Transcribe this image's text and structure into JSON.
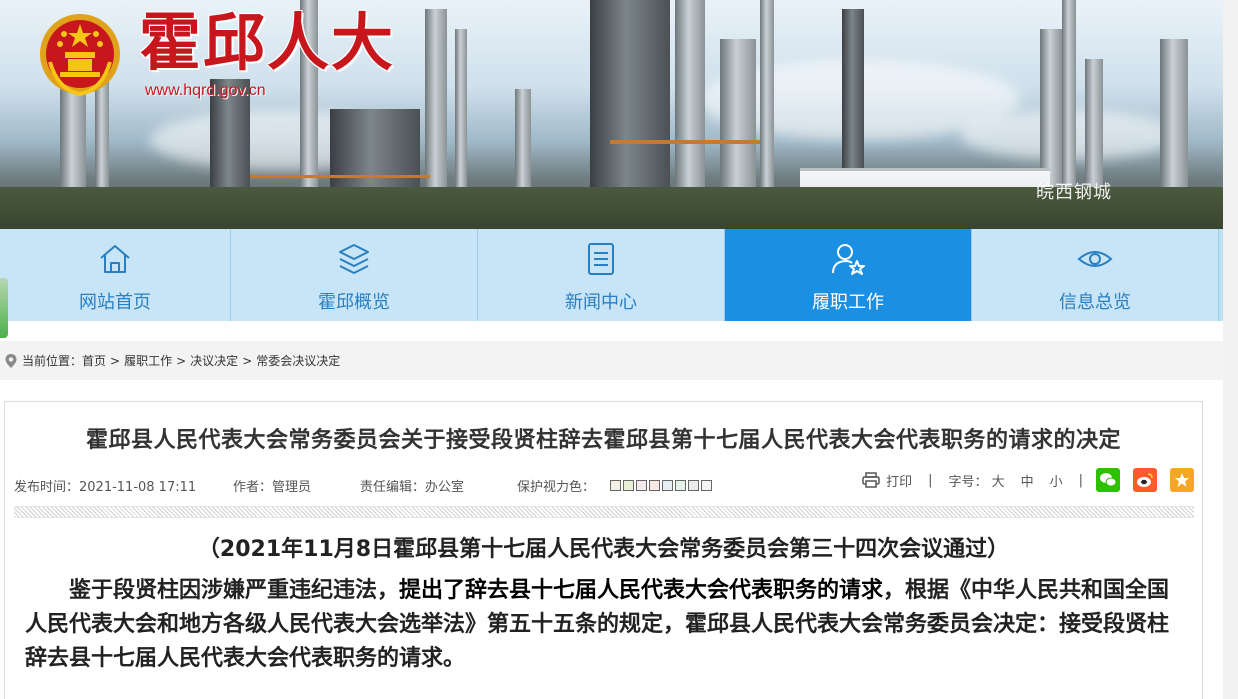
{
  "header": {
    "site_title": "霍邱人大",
    "site_url": "www.hqrd.gov.cn",
    "watermark": "皖西钢城"
  },
  "nav": {
    "items": [
      {
        "label": "网站首页",
        "icon": "home-icon",
        "active": false
      },
      {
        "label": "霍邱概览",
        "icon": "layers-icon",
        "active": false
      },
      {
        "label": "新闻中心",
        "icon": "list-icon",
        "active": false
      },
      {
        "label": "履职工作",
        "icon": "user-star-icon",
        "active": true
      },
      {
        "label": "信息总览",
        "icon": "eye-icon",
        "active": false
      }
    ],
    "active_color": "#1b8fe2",
    "bg_color": "#c7e5f6"
  },
  "breadcrumb": {
    "prefix": "当前位置：",
    "items": [
      "首页",
      "履职工作",
      "决议决定",
      "常委会决议决定"
    ],
    "separator": ">"
  },
  "article": {
    "title": "霍邱县人民代表大会常务委员会关于接受段贤柱辞去霍邱县第十七届人民代表大会代表职务的请求的决定",
    "meta": {
      "publish": "发布时间：2021-11-08 17:11",
      "author": "作者：管理员",
      "editor": "责任编辑：办公室",
      "eye_color_label": "保护视力色：",
      "eye_colors": [
        "#f5f0e6",
        "#e8f0d8",
        "#f3eaf0",
        "#f9e7e4",
        "#e9eef3",
        "#e3f2e8",
        "#ececec",
        "#f5f5f5"
      ]
    },
    "tools": {
      "print": "打印",
      "font_size": "字号：",
      "big": "大",
      "medium": "中",
      "small": "小",
      "divider": "|"
    },
    "subtitle": "（2021年11月8日霍邱县第十七届人民代表大会常务委员会第三十四次会议通过）",
    "body": {
      "part1": "鉴于段贤柱因涉嫌严重违纪违法，",
      "part2": "提出了辞去县十七届人民代表大会代表职务的请求",
      "part3": "，根据《中华人民共和国全国人民代表大会和地方各级人民代表大会选举法》第五十五条的规定，霍邱县人民代表大会常务委员会决定：接受段贤柱辞去县十七届人民代表大会代表职务的请求。"
    }
  },
  "colors": {
    "title_red": "#c8161d",
    "nav_text": "#2a7fc1"
  }
}
